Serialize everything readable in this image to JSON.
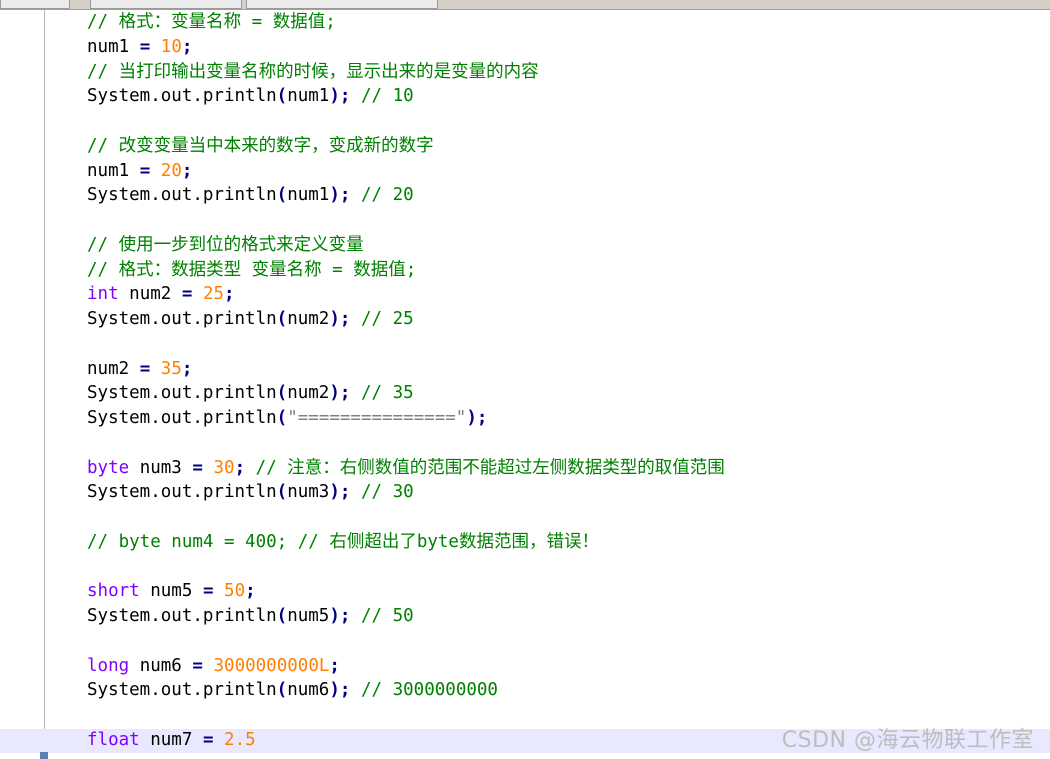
{
  "editor": {
    "lines": [
      {
        "kind": "comment",
        "text": "// 格式：变量名称 = 数据值;"
      },
      {
        "kind": "assign",
        "name": "num1",
        "value": "10"
      },
      {
        "kind": "comment",
        "text": "// 当打印输出变量名称的时候，显示出来的是变量的内容"
      },
      {
        "kind": "print",
        "expr": "num1",
        "comment": "// 10"
      },
      {
        "kind": "blank"
      },
      {
        "kind": "comment",
        "text": "// 改变变量当中本来的数字，变成新的数字"
      },
      {
        "kind": "assign",
        "name": "num1",
        "value": "20"
      },
      {
        "kind": "print",
        "expr": "num1",
        "comment": "// 20"
      },
      {
        "kind": "blank"
      },
      {
        "kind": "comment",
        "text": "// 使用一步到位的格式来定义变量"
      },
      {
        "kind": "comment",
        "text": "// 格式：数据类型 变量名称 = 数据值;"
      },
      {
        "kind": "decl",
        "type": "int",
        "name": "num2",
        "value": "25"
      },
      {
        "kind": "print",
        "expr": "num2",
        "comment": "// 25"
      },
      {
        "kind": "blank"
      },
      {
        "kind": "assign",
        "name": "num2",
        "value": "35"
      },
      {
        "kind": "print",
        "expr": "num2",
        "comment": "// 35"
      },
      {
        "kind": "printstr",
        "str": "\"===============\""
      },
      {
        "kind": "blank"
      },
      {
        "kind": "decl",
        "type": "byte",
        "name": "num3",
        "value": "30",
        "comment": "// 注意：右侧数值的范围不能超过左侧数据类型的取值范围"
      },
      {
        "kind": "print",
        "expr": "num3",
        "comment": "// 30"
      },
      {
        "kind": "blank"
      },
      {
        "kind": "comment",
        "text": "// byte num4 = 400; // 右侧超出了byte数据范围，错误！"
      },
      {
        "kind": "blank"
      },
      {
        "kind": "decl",
        "type": "short",
        "name": "num5",
        "value": "50"
      },
      {
        "kind": "print",
        "expr": "num5",
        "comment": "// 50"
      },
      {
        "kind": "blank"
      },
      {
        "kind": "decl",
        "type": "long",
        "name": "num6",
        "value": "3000000000L"
      },
      {
        "kind": "print",
        "expr": "num6",
        "comment": "// 3000000000"
      },
      {
        "kind": "blank"
      },
      {
        "kind": "declopen",
        "type": "float",
        "name": "num7",
        "value": "2.5"
      }
    ],
    "tokens": {
      "print_call": "System.out.println",
      "eq": "=",
      "semi": ";",
      "lparen": "(",
      "rparen": ")"
    }
  },
  "watermark": "CSDN @海云物联工作室",
  "colors": {
    "comment": "#008000",
    "keyword": "#8000ff",
    "number": "#ff8000",
    "operator": "#000080",
    "string": "#808080",
    "current_line": "#e8e8ff"
  }
}
